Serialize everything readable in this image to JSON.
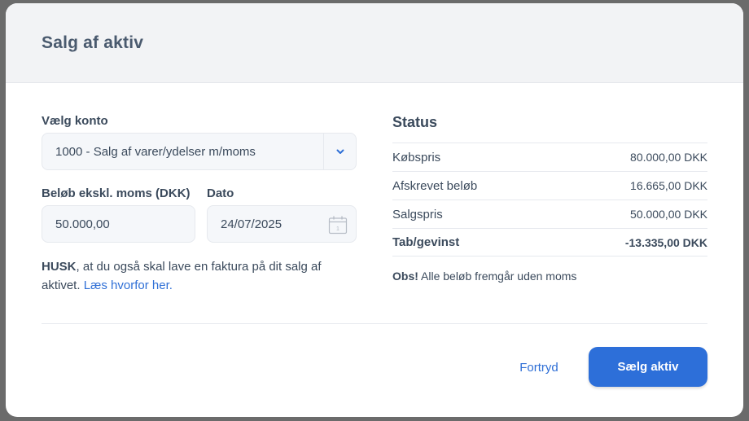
{
  "modal": {
    "title": "Salg af aktiv"
  },
  "form": {
    "account": {
      "label": "Vælg konto",
      "value": "1000 - Salg af varer/ydelser m/moms"
    },
    "amount": {
      "label": "Beløb ekskl. moms (DKK)",
      "value": "50.000,00"
    },
    "date": {
      "label": "Dato",
      "value": "24/07/2025",
      "calendar_day": "1"
    },
    "note": {
      "bold": "HUSK",
      "text": ", at du også skal lave en faktura på dit salg af aktivet. ",
      "link": "Læs hvorfor her."
    }
  },
  "status": {
    "title": "Status",
    "rows": [
      {
        "label": "Købspris",
        "value": "80.000,00 DKK"
      },
      {
        "label": "Afskrevet beløb",
        "value": "16.665,00 DKK"
      },
      {
        "label": "Salgspris",
        "value": "50.000,00 DKK"
      },
      {
        "label": "Tab/gevinst",
        "value": "-13.335,00 DKK"
      }
    ],
    "obs_bold": "Obs!",
    "obs_text": " Alle beløb fremgår uden moms"
  },
  "actions": {
    "cancel": "Fortryd",
    "submit": "Sælg aktiv"
  },
  "colors": {
    "accent": "#2d6fd9",
    "link": "#2f6fd6"
  },
  "icons": {
    "dropdown": "chevron-down-icon",
    "date": "calendar-icon"
  }
}
